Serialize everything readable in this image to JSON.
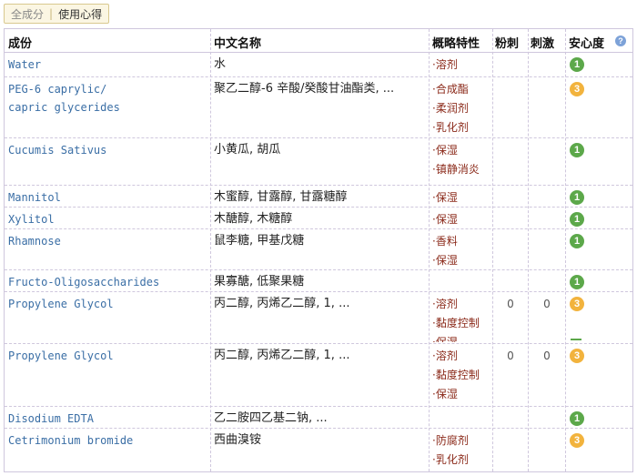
{
  "tabs": {
    "all": "全成分",
    "sep": "|",
    "usage": "使用心得"
  },
  "header": {
    "ingredient": "成份",
    "chinese_name": "中文名称",
    "properties": "概略特性",
    "acne": "粉刺",
    "irritation": "刺激",
    "safety": "安心度"
  },
  "colors": {
    "green_badge": "#5ca84a",
    "yellow_badge": "#f2b33d",
    "ingredient_link": "#3a6ea5",
    "property_text": "#8b2a1a"
  },
  "rows": [
    {
      "en": [
        "Water"
      ],
      "cn": "水",
      "props": [
        "·溶剂"
      ],
      "acne": "",
      "irritation": "",
      "safety": "1",
      "safety_color": "green"
    },
    {
      "en": [
        "PEG-6 caprylic/",
        "capric glycerides"
      ],
      "cn": "聚乙二醇-6 辛酸/癸酸甘油酯类, ...",
      "props": [
        "·合成酯",
        "·柔润剂",
        "·乳化剂"
      ],
      "acne": "",
      "irritation": "",
      "safety": "3",
      "safety_color": "yellow"
    },
    {
      "en": [
        "Cucumis Sativus"
      ],
      "cn": "小黄瓜, 胡瓜",
      "props": [
        "·保湿",
        "·镇静消炎"
      ],
      "acne": "",
      "irritation": "",
      "safety": "1",
      "safety_color": "green"
    },
    {
      "en": [
        "Mannitol"
      ],
      "cn": "木蜜醇, 甘露醇, 甘露糖醇",
      "props": [
        "·保湿"
      ],
      "acne": "",
      "irritation": "",
      "safety": "1",
      "safety_color": "green"
    },
    {
      "en": [
        "Xylitol"
      ],
      "cn": "木醣醇, 木糖醇",
      "props": [
        "·保湿"
      ],
      "acne": "",
      "irritation": "",
      "safety": "1",
      "safety_color": "green"
    },
    {
      "en": [
        "Rhamnose"
      ],
      "cn": "鼠李糖, 甲基戊糖",
      "props": [
        "·香料",
        "·保湿"
      ],
      "acne": "",
      "irritation": "",
      "safety": "1",
      "safety_color": "green"
    },
    {
      "en": [
        "Fructo-Oligosaccharides"
      ],
      "cn": "果寡醣, 低聚果糖",
      "props": [],
      "acne": "",
      "irritation": "",
      "safety": "1",
      "safety_color": "green"
    },
    {
      "en": [
        "Propylene Glycol"
      ],
      "cn": "丙二醇, 丙烯乙二醇, 1, ...",
      "props": [
        "·溶剂",
        "·黏度控制",
        "·保湿"
      ],
      "acne": "0",
      "irritation": "0",
      "safety": "3",
      "safety_color": "yellow"
    },
    {
      "en": [
        "Propylene Glycol"
      ],
      "cn": "丙二醇, 丙烯乙二醇, 1, ...",
      "props": [
        "·溶剂",
        "·黏度控制",
        "·保湿"
      ],
      "acne": "0",
      "irritation": "0",
      "safety": "3",
      "safety_color": "yellow"
    },
    {
      "en": [
        "Disodium EDTA"
      ],
      "cn": "乙二胺四乙基二钠, ...",
      "props": [],
      "acne": "",
      "irritation": "",
      "safety": "1",
      "safety_color": "green"
    },
    {
      "en": [
        "Cetrimonium bromide"
      ],
      "cn": "西曲溴铵",
      "props": [
        "·防腐剂",
        "·乳化剂"
      ],
      "acne": "",
      "irritation": "",
      "safety": "3",
      "safety_color": "yellow"
    }
  ]
}
